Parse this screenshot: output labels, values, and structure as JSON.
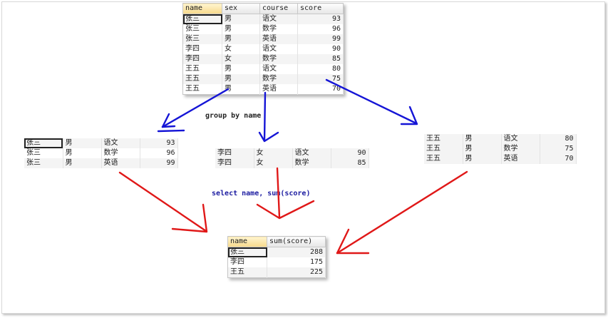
{
  "source_table": {
    "headers": [
      "name",
      "sex",
      "course",
      "score"
    ],
    "rows": [
      [
        "张三",
        "男",
        "语文",
        "93"
      ],
      [
        "张三",
        "男",
        "数学",
        "96"
      ],
      [
        "张三",
        "男",
        "英语",
        "99"
      ],
      [
        "李四",
        "女",
        "语文",
        "90"
      ],
      [
        "李四",
        "女",
        "数学",
        "85"
      ],
      [
        "王五",
        "男",
        "语文",
        "80"
      ],
      [
        "王五",
        "男",
        "数学",
        "75"
      ],
      [
        "王五",
        "男",
        "英语",
        "70"
      ]
    ]
  },
  "label_group_by": "group by name",
  "label_select": "select name, sum(score)",
  "group_zhangsan": [
    [
      "张三",
      "男",
      "语文",
      "93"
    ],
    [
      "张三",
      "男",
      "数学",
      "96"
    ],
    [
      "张三",
      "男",
      "英语",
      "99"
    ]
  ],
  "group_lisi": [
    [
      "李四",
      "女",
      "语文",
      "90"
    ],
    [
      "李四",
      "女",
      "数学",
      "85"
    ]
  ],
  "group_wangwu": [
    [
      "王五",
      "男",
      "语文",
      "80"
    ],
    [
      "王五",
      "男",
      "数学",
      "75"
    ],
    [
      "王五",
      "男",
      "英语",
      "70"
    ]
  ],
  "result_table": {
    "headers": [
      "name",
      "sum(score)"
    ],
    "rows": [
      [
        "张三",
        "288"
      ],
      [
        "李四",
        "175"
      ],
      [
        "王五",
        "225"
      ]
    ]
  },
  "colors": {
    "blue_arrow": "#1515d6",
    "red_arrow": "#e01818",
    "label_blue": "#1a1aa0",
    "label_dark": "#222222"
  }
}
